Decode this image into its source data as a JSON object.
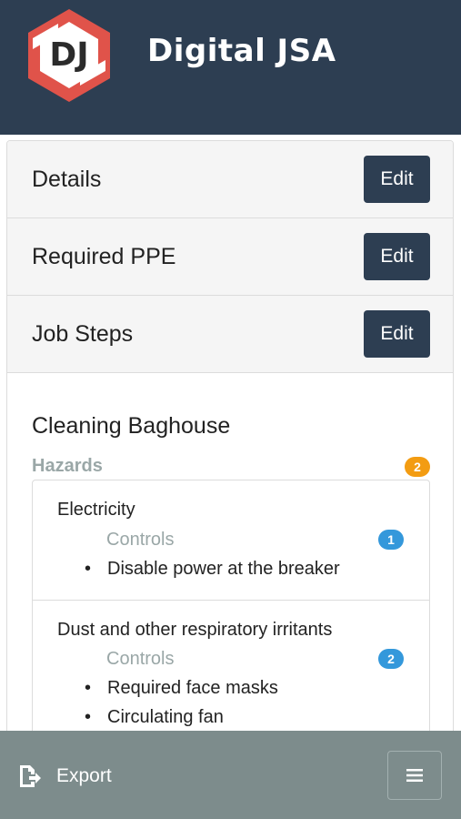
{
  "header": {
    "logo_text": "DJ",
    "title": "Digital JSA"
  },
  "sections": [
    {
      "title": "Details",
      "button": "Edit"
    },
    {
      "title": "Required PPE",
      "button": "Edit"
    },
    {
      "title": "Job Steps",
      "button": "Edit"
    }
  ],
  "job_step": {
    "title": "Cleaning Baghouse",
    "hazards_label": "Hazards",
    "hazards_count": "2",
    "hazards": [
      {
        "name": "Electricity",
        "controls_label": "Controls",
        "controls_count": "1",
        "controls": [
          "Disable power at the breaker"
        ]
      },
      {
        "name": "Dust and other respiratory irritants",
        "controls_label": "Controls",
        "controls_count": "2",
        "controls": [
          "Required face masks",
          "Circulating fan"
        ]
      }
    ]
  },
  "footer": {
    "export_label": "Export",
    "export_icon": "export-icon",
    "menu_icon": "hamburger-menu-icon"
  },
  "colors": {
    "header_bg": "#2d3e52",
    "button_bg": "#2d3e52",
    "footer_bg": "#7d8c8c",
    "badge_orange": "#f39c12",
    "badge_blue": "#3498db",
    "muted_label": "#9aa7a7",
    "logo_red": "#e0534a"
  }
}
